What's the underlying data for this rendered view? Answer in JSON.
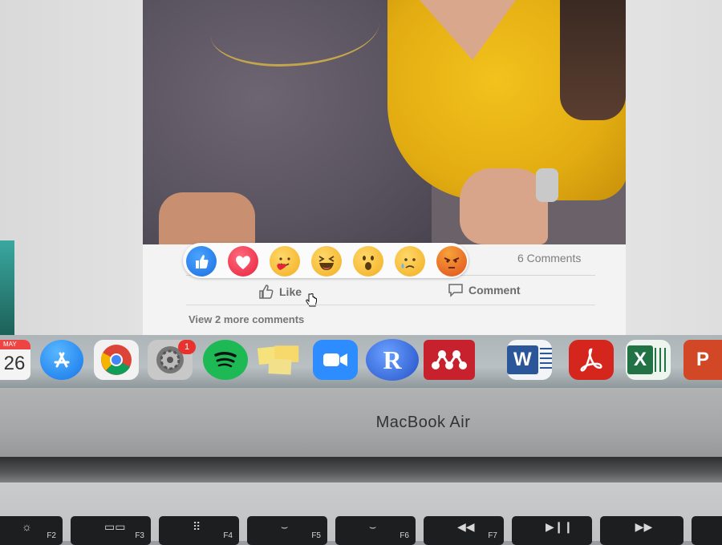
{
  "post": {
    "comments_count": "6 Comments",
    "like_label": "Like",
    "comment_label": "Comment",
    "view_more": "View 2 more comments"
  },
  "reactions": [
    {
      "name": "like",
      "icon": "thumbs-up-icon"
    },
    {
      "name": "love",
      "icon": "heart-icon"
    },
    {
      "name": "care",
      "icon": "hug-face-icon"
    },
    {
      "name": "haha",
      "icon": "laughing-face-icon"
    },
    {
      "name": "wow",
      "icon": "surprised-face-icon"
    },
    {
      "name": "sad",
      "icon": "crying-face-icon"
    },
    {
      "name": "angry",
      "icon": "angry-face-icon"
    }
  ],
  "dock": {
    "calendar_month": "MAY",
    "calendar_day": "26",
    "prefs_badge": "1",
    "r_label": "R",
    "word_label": "W",
    "excel_label": "X",
    "ppt_label": "P",
    "apps": [
      "Calendar",
      "App Store",
      "Chrome",
      "System Preferences",
      "Spotify",
      "Stickies",
      "Zoom",
      "RStudio",
      "Mendeley",
      "Word",
      "Acrobat",
      "Excel",
      "PowerPoint"
    ]
  },
  "laptop": {
    "brand": "MacBook Air"
  },
  "keys": [
    {
      "label": "F2",
      "icon": "brightness-up-icon"
    },
    {
      "label": "F3",
      "icon": "mission-control-icon"
    },
    {
      "label": "F4",
      "icon": "launchpad-icon"
    },
    {
      "label": "F5",
      "icon": "keyboard-light-down-icon"
    },
    {
      "label": "F6",
      "icon": "keyboard-light-up-icon"
    },
    {
      "label": "F7",
      "icon": "rewind-icon"
    },
    {
      "label": "",
      "icon": "play-pause-icon"
    },
    {
      "label": "",
      "icon": "fast-forward-icon"
    }
  ],
  "colors": {
    "like_blue": "#1b6fe0",
    "love_red": "#e8213c",
    "yellow_shirt": "#e3ad12",
    "badge_red": "#e8322e"
  }
}
